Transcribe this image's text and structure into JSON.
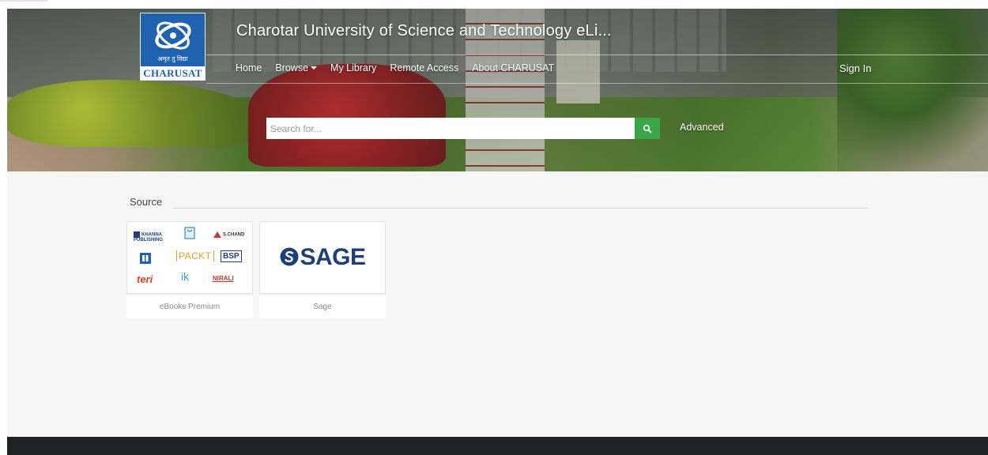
{
  "header": {
    "logo_tagline": "अमृत तु विद्या",
    "logo_wordmark": "CHARUSAT",
    "site_title": "Charotar University of Science and Technology eLi...",
    "nav": [
      {
        "label": "Home"
      },
      {
        "label": "Browse"
      },
      {
        "label": "My Library"
      },
      {
        "label": "Remote Access"
      },
      {
        "label": "About CHARUSAT"
      }
    ],
    "sign_in": "Sign In",
    "search": {
      "placeholder": "Search for...",
      "value": "",
      "button_icon": "search-icon"
    },
    "advanced": "Advanced"
  },
  "content": {
    "section_title": "Source",
    "sources": [
      {
        "name": "eBooks Premium",
        "publishers": [
          "KHANNA PUBLISHING",
          "S.CHAND",
          "PACKT",
          "BSP",
          "teri",
          "ik",
          "NIRALI"
        ]
      },
      {
        "name": "Sage",
        "logo_text": "SAGE"
      }
    ]
  },
  "colors": {
    "logo_blue": "#1f63b0",
    "search_button": "#3aa648",
    "footer": "#1f2224",
    "content_bg": "#f6f6f6",
    "sage_blue": "#1c3f7a"
  }
}
